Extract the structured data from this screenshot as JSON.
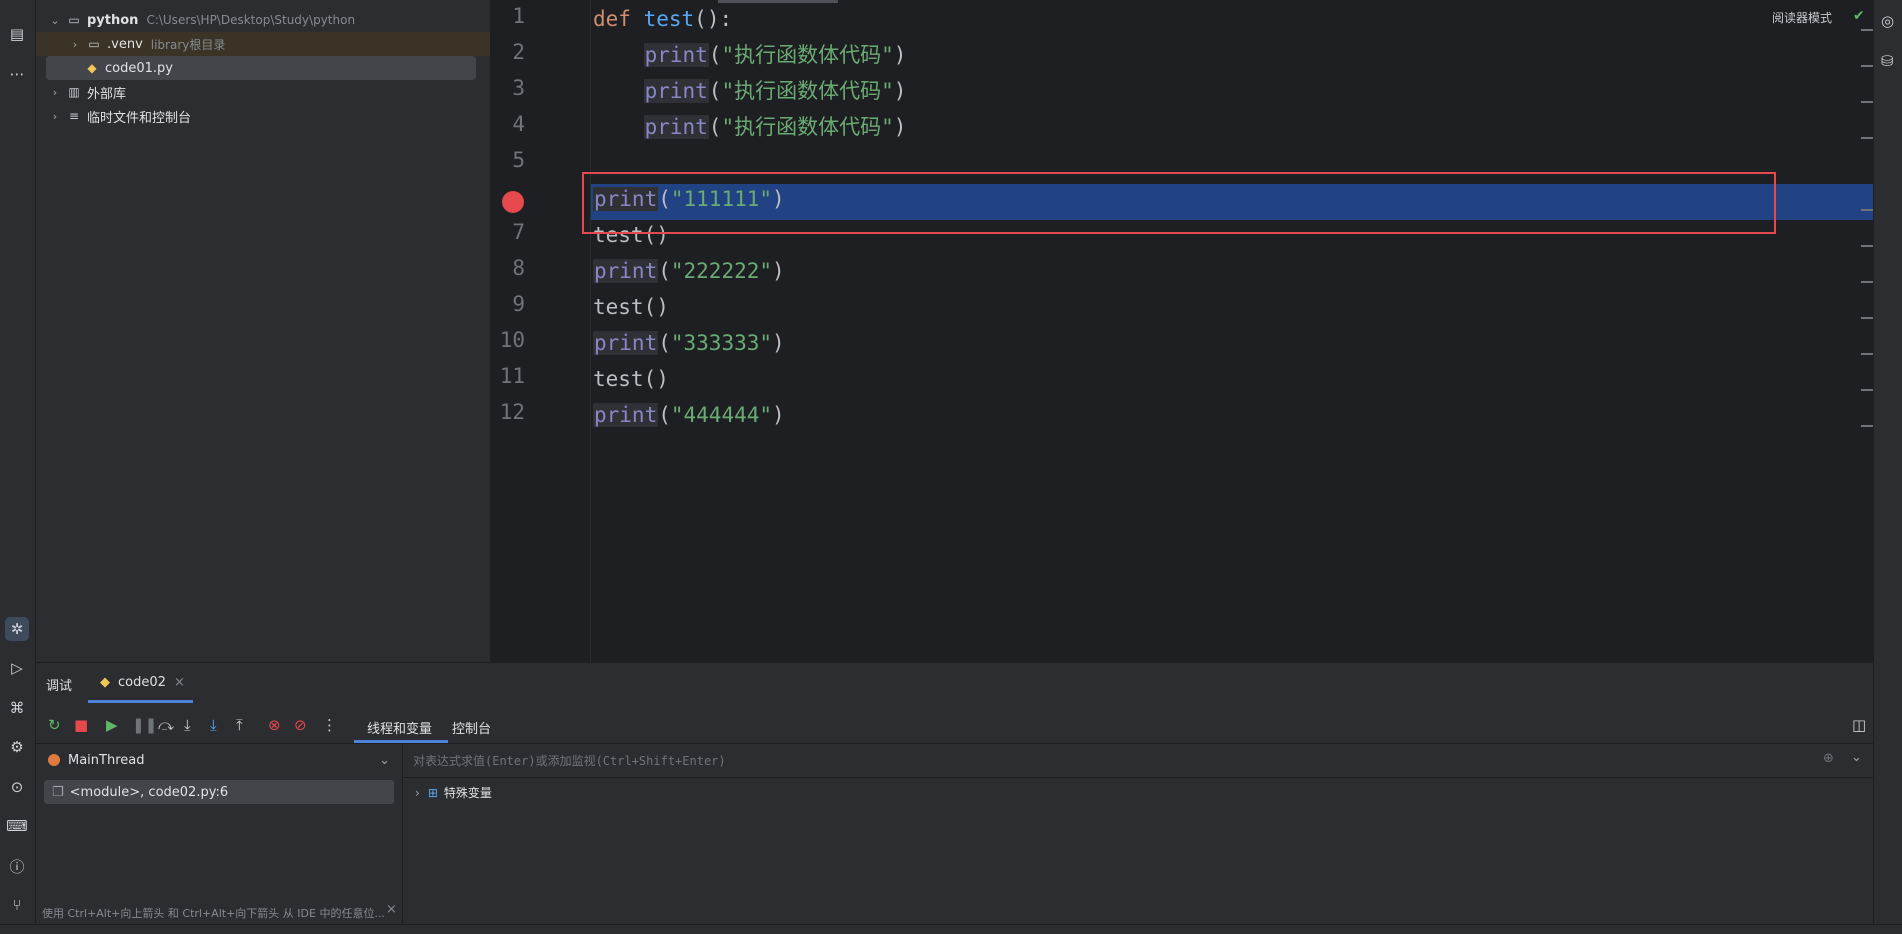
{
  "activity_bar": {
    "icons": [
      "project-icon",
      "more-icon",
      "debug-icon",
      "run-icon",
      "python-console-icon",
      "python-packages-icon",
      "services-icon",
      "terminal-icon",
      "problems-icon",
      "git-icon"
    ]
  },
  "project_tree": {
    "root": {
      "name": "python",
      "path": "C:\\Users\\HP\\Desktop\\Study\\python"
    },
    "venv": {
      "name": ".venv",
      "hint": "library根目录"
    },
    "file": {
      "name": "code01.py"
    },
    "external": {
      "name": "外部库"
    },
    "scratches": {
      "name": "临时文件和控制台"
    }
  },
  "editor": {
    "reader_mode": "阅读器模式",
    "line_numbers": [
      "1",
      "2",
      "3",
      "4",
      "5",
      "",
      "7",
      "8",
      "9",
      "10",
      "11",
      "12"
    ],
    "lines": [
      {
        "kw": "def",
        "fn": "test",
        "rest": "():"
      },
      {
        "indent": "    ",
        "pr": "print",
        "paren_open": "(",
        "str": "\"执行函数体代码\"",
        "paren_close": ")"
      },
      {
        "indent": "    ",
        "pr": "print",
        "paren_open": "(",
        "str": "\"执行函数体代码\"",
        "paren_close": ")"
      },
      {
        "indent": "    ",
        "pr": "print",
        "paren_open": "(",
        "str": "\"执行函数体代码\"",
        "paren_close": ")"
      },
      {},
      {
        "pr": "print",
        "paren_open": "(",
        "str": "\"111111\"",
        "paren_close": ")"
      },
      {
        "plain": "test()"
      },
      {
        "pr": "print",
        "paren_open": "(",
        "str": "\"222222\"",
        "paren_close": ")"
      },
      {
        "plain": "test()"
      },
      {
        "pr": "print",
        "paren_open": "(",
        "str": "\"333333\"",
        "paren_close": ")"
      },
      {
        "plain": "test()"
      },
      {
        "pr": "print",
        "paren_open": "(",
        "str": "\"444444\"",
        "paren_close": ")"
      }
    ],
    "breakpoint_line": 6,
    "accent_highlight": "#214283",
    "box_color": "#e5484d"
  },
  "debug_panel": {
    "tab_debug": "调试",
    "tab_config": "code02",
    "toolbar_tab_threads": "线程和变量",
    "toolbar_tab_console": "控制台",
    "thread_name": "MainThread",
    "frame": "<module>, code02.py:6",
    "eval_placeholder": "对表达式求值(Enter)或添加监视(Ctrl+Shift+Enter)",
    "special_vars": "特殊变量",
    "hint": "使用 Ctrl+Alt+向上箭头 和 Ctrl+Alt+向下箭头 从 IDE 中的任意位..."
  }
}
